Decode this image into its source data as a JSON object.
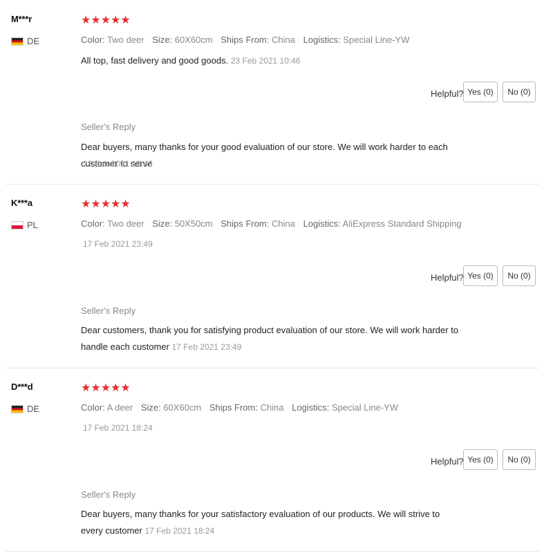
{
  "reviews": [
    {
      "name": "M***r",
      "country": "DE",
      "stars": "★★★★★",
      "attrs": {
        "color_label": "Color:",
        "color": "Two deer",
        "size_label": "Size:",
        "size": "60X60cm",
        "ships_label": "Ships From:",
        "ships": "China",
        "logistics_label": "Logistics:",
        "logistics": "Special Line-YW"
      },
      "content": "All top, fast delivery and good goods.",
      "date": "23 Feb 2021 10:46",
      "helpful_label": "Helpful?",
      "yes_label": "Yes (0)",
      "no_label": "No (0)",
      "reply_title": "Seller's Reply",
      "reply_text": "Dear buyers, many thanks for your good evaluation of our store. We will work harder to each customer to serve",
      "reply_date": "23 Feb 2021 10:46"
    },
    {
      "name": "K***a",
      "country": "PL",
      "stars": "★★★★★",
      "attrs": {
        "color_label": "Color:",
        "color": "Two deer",
        "size_label": "Size:",
        "size": "50X50cm",
        "ships_label": "Ships From:",
        "ships": "China",
        "logistics_label": "Logistics:",
        "logistics": "AliExpress Standard Shipping"
      },
      "date": "17 Feb 2021 23:49",
      "helpful_label": "Helpful?",
      "yes_label": "Yes (0)",
      "no_label": "No (0)",
      "reply_title": "Seller's Reply",
      "reply_text": "Dear customers, thank you for satisfying product evaluation of our store. We will work harder to handle each customer",
      "reply_date": "17 Feb 2021 23:49"
    },
    {
      "name": "D***d",
      "country": "DE",
      "stars": "★★★★★",
      "attrs": {
        "color_label": "Color:",
        "color": "A deer",
        "size_label": "Size:",
        "size": "60X60cm",
        "ships_label": "Ships From:",
        "ships": "China",
        "logistics_label": "Logistics:",
        "logistics": "Special Line-YW"
      },
      "date": "17 Feb 2021 18:24",
      "helpful_label": "Helpful?",
      "yes_label": "Yes (0)",
      "no_label": "No (0)",
      "reply_title": "Seller's Reply",
      "reply_text": "Dear buyers, many thanks for your satisfactory evaluation of our products. We will strive to every customer",
      "reply_date": "17 Feb 2021 18:24"
    }
  ],
  "colors": {
    "star": "#e62e2e",
    "muted": "#888888",
    "divider": "#e6e6e6"
  }
}
